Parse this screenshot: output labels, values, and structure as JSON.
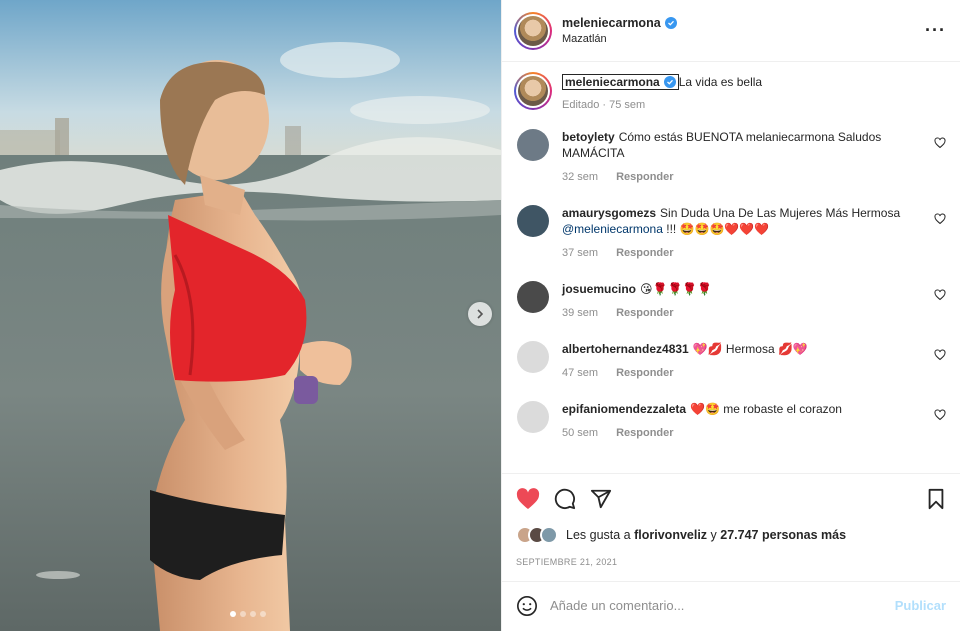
{
  "post": {
    "username": "meleniecarmona",
    "location": "Mazatlán",
    "caption": "La vida es bella",
    "caption_meta": "Editado · 75 sem",
    "media_dots": 4,
    "active_dot": 0
  },
  "comments": [
    {
      "user": "betoylety",
      "text": "Cómo estás BUENOTA melaniecarmona Saludos MAMÁCITA",
      "emoji": "",
      "time": "32 sem",
      "reply": "Responder",
      "avatar": "#6d7a86"
    },
    {
      "user": "amaurysgomezs",
      "text": "Sin Duda Una De Las Mujeres Más Hermosa",
      "mention": "@meleniecarmona",
      "suffix": " !!! ",
      "emoji": "🤩🤩🤩❤️❤️❤️",
      "time": "37 sem",
      "reply": "Responder",
      "avatar": "#3f5564"
    },
    {
      "user": "josuemucino",
      "text": "",
      "emoji": "😘🌹🌹🌹🌹",
      "time": "39 sem",
      "reply": "Responder",
      "avatar": "#4a4a4a"
    },
    {
      "user": "albertohernandez4831",
      "text": "💖💋 Hermosa 💋💖",
      "emoji": "",
      "time": "47 sem",
      "reply": "Responder",
      "avatar": "#dbdbdb"
    },
    {
      "user": "epifaniomendezzaleta",
      "text": "❤️🤩 me robaste el corazon",
      "emoji": "",
      "time": "50 sem",
      "reply": "Responder",
      "avatar": "#dbdbdb"
    }
  ],
  "likes": {
    "prefix": "Les gusta a",
    "user": "florivonveliz",
    "middle": "y",
    "count": "27.747 personas más"
  },
  "date": "SEPTIEMBRE 21, 2021",
  "add_comment": {
    "placeholder": "Añade un comentario...",
    "publish": "Publicar"
  },
  "icons": {
    "like": "heart-filled-icon",
    "comment": "comment-icon",
    "share": "share-icon",
    "save": "bookmark-icon",
    "more": "more-options-icon",
    "next": "chevron-right-icon",
    "emoji": "emoji-icon"
  },
  "colors": {
    "like_red": "#ed4956",
    "verified_blue": "#3897f0",
    "publish_disabled": "#b2dffc",
    "meta_gray": "#8e8e8e"
  }
}
